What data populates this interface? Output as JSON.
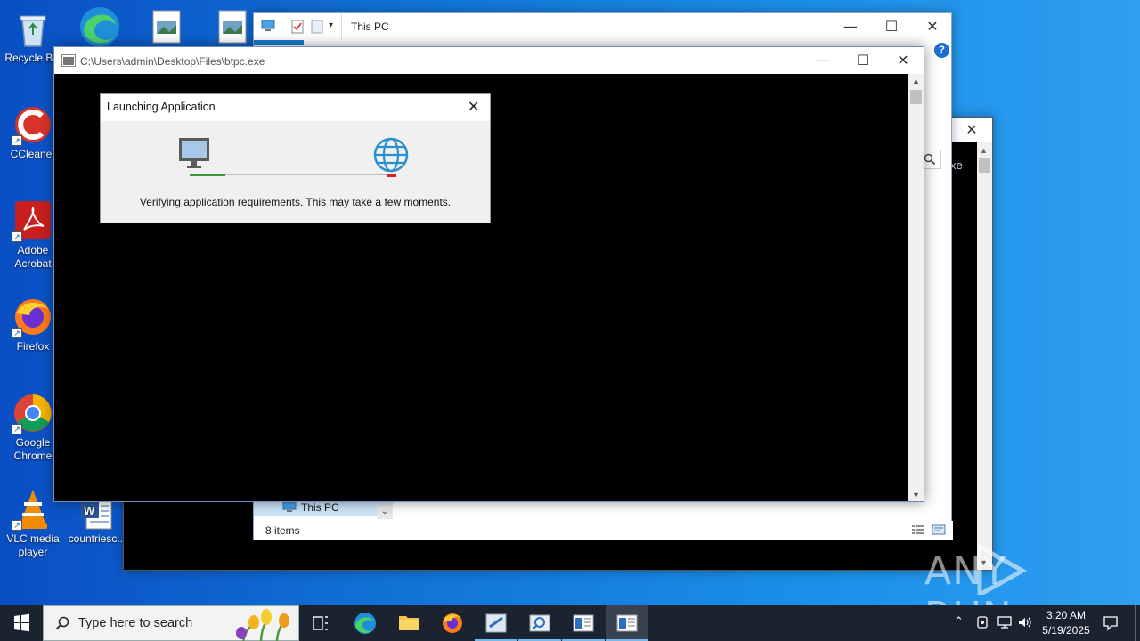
{
  "desktop": {
    "icons": [
      {
        "label": "Recycle Bin",
        "icon": "recycle-bin-icon"
      },
      {
        "label": "CCleaner",
        "icon": "ccleaner-icon"
      },
      {
        "label": "Adobe Acrobat",
        "icon": "acrobat-icon"
      },
      {
        "label": "Firefox",
        "icon": "firefox-icon"
      },
      {
        "label": "Google Chrome",
        "icon": "chrome-icon"
      },
      {
        "label": "VLC media player",
        "icon": "vlc-icon"
      },
      {
        "label": "countriesc...",
        "icon": "word-document-icon"
      }
    ],
    "top_icons": [
      "edge-icon",
      "image-file-icon",
      "image-file-icon"
    ]
  },
  "explorer_window": {
    "title": "This PC",
    "status": "8 items",
    "nav_item": "This PC",
    "help_glyph": "?"
  },
  "background_window": {
    "partial_text": "xe"
  },
  "console_window": {
    "title": "C:\\Users\\admin\\Desktop\\Files\\btpc.exe"
  },
  "dialog": {
    "title": "Launching Application",
    "message": "Verifying application requirements. This may take a few moments."
  },
  "taskbar": {
    "search_placeholder": "Type here to search",
    "time": "3:20 AM",
    "date": "5/19/2025"
  },
  "watermark": {
    "text": "ANY RUN"
  },
  "colors": {
    "accent": "#0078d7",
    "progress_green": "#3c9a3c",
    "progress_red": "#e02020",
    "console_bg": "#000000"
  }
}
